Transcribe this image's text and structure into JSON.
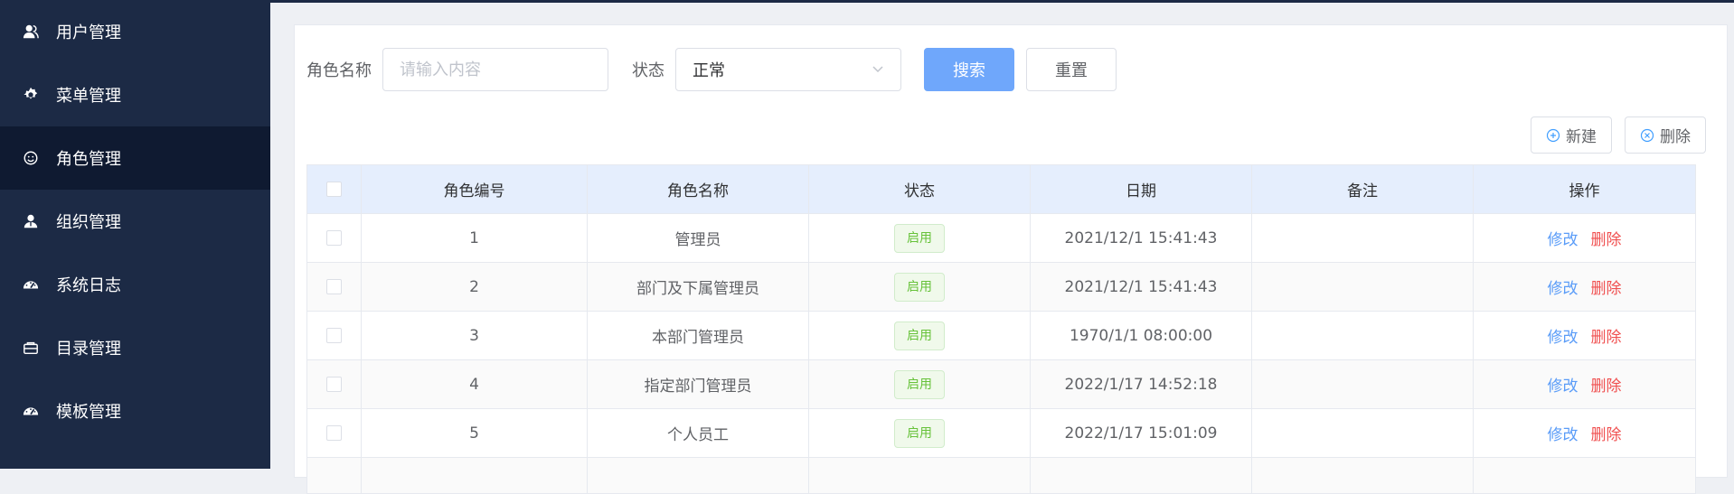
{
  "sidebar": {
    "items": [
      {
        "label": "用户管理",
        "icon": "user-icon"
      },
      {
        "label": "菜单管理",
        "icon": "gear-icon"
      },
      {
        "label": "角色管理",
        "icon": "smile-icon"
      },
      {
        "label": "组织管理",
        "icon": "org-icon"
      },
      {
        "label": "系统日志",
        "icon": "dashboard-icon"
      },
      {
        "label": "目录管理",
        "icon": "folder-icon"
      },
      {
        "label": "模板管理",
        "icon": "dashboard-icon"
      }
    ],
    "active_index": 2
  },
  "search": {
    "role_name_label": "角色名称",
    "role_name_placeholder": "请输入内容",
    "role_name_value": "",
    "status_label": "状态",
    "status_value": "正常",
    "search_button": "搜索",
    "reset_button": "重置"
  },
  "actions": {
    "new_button": "新建",
    "delete_button": "删除"
  },
  "table": {
    "headers": [
      "角色编号",
      "角色名称",
      "状态",
      "日期",
      "备注",
      "操作"
    ],
    "rows": [
      {
        "id": "1",
        "name": "管理员",
        "status": "启用",
        "date": "2021/12/1 15:41:43",
        "note": "",
        "edit": "修改",
        "del": "删除"
      },
      {
        "id": "2",
        "name": "部门及下属管理员",
        "status": "启用",
        "date": "2021/12/1 15:41:43",
        "note": "",
        "edit": "修改",
        "del": "删除"
      },
      {
        "id": "3",
        "name": "本部门管理员",
        "status": "启用",
        "date": "1970/1/1 08:00:00",
        "note": "",
        "edit": "修改",
        "del": "删除"
      },
      {
        "id": "4",
        "name": "指定部门管理员",
        "status": "启用",
        "date": "2022/1/17 14:52:18",
        "note": "",
        "edit": "修改",
        "del": "删除"
      },
      {
        "id": "5",
        "name": "个人员工",
        "status": "启用",
        "date": "2022/1/17 15:01:09",
        "note": "",
        "edit": "修改",
        "del": "删除"
      }
    ]
  },
  "colors": {
    "sidebar_bg": "#1c2a45",
    "sidebar_active_bg": "#0f1a31",
    "primary": "#6fa7fb",
    "header_bg": "#e5eefd",
    "success": "#67c23a",
    "danger": "#f05050",
    "link": "#5a9cf8"
  }
}
